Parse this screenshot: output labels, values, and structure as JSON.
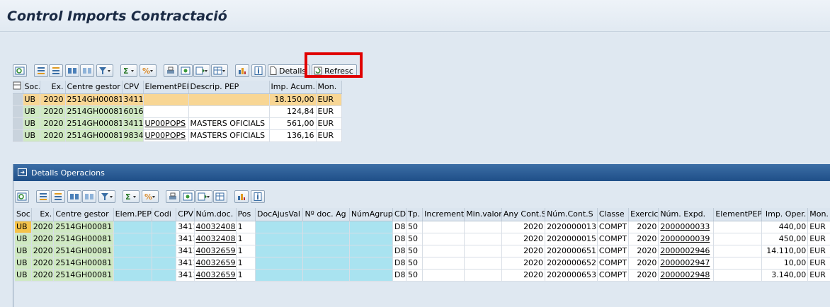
{
  "title": "Control Imports Contractació",
  "toolbar1": {
    "icons": [
      "details-icon",
      "align-left-icon",
      "align-center-icon",
      "find-icon",
      "find-next-icon",
      "filter-icon",
      "sum-icon",
      "subtotal-icon",
      "print-icon",
      "view-icon",
      "export-icon",
      "layout-icon",
      "graphic-icon",
      "info-icon"
    ],
    "details_label": "Detalls",
    "refresh_label": "Refresc"
  },
  "top_table": {
    "columns": [
      "Soc.",
      "Ex.",
      "Centre gestor",
      "CPV",
      "ElementPEP",
      "Descrip. PEP",
      "Imp. Acum.",
      "Mon."
    ],
    "rows": [
      [
        "UB",
        "2020",
        "2514GH00081",
        "3411",
        "",
        "",
        "18.150,00",
        "EUR"
      ],
      [
        "UB",
        "2020",
        "2514GH00081",
        "6016",
        "",
        "",
        "124,84",
        "EUR"
      ],
      [
        "UB",
        "2020",
        "2514GH00081",
        "3411",
        "UP00POPS",
        "MASTERS OFICIALS",
        "561,00",
        "EUR"
      ],
      [
        "UB",
        "2020",
        "2514GH00081",
        "9834",
        "UP00POPS",
        "MASTERS OFICIALS",
        "136,16",
        "EUR"
      ]
    ]
  },
  "panel2": {
    "title": "Detalls Operacions"
  },
  "bottom_table": {
    "columns": [
      "Soc.",
      "Ex.",
      "Centre gestor",
      "Elem.PEP",
      "Codi",
      "CPV",
      "Núm.doc.",
      "Pos",
      "DocAjusVal",
      "Nº doc. Ag",
      "NúmAgrup",
      "CD",
      "Tp.",
      "Increment",
      "Min.valor",
      "Any Cont.S",
      "Núm.Cont.S",
      "Classe",
      "Exercici",
      "Núm. Expd.",
      "ElementPEP",
      "Imp. Oper.",
      "Mon."
    ],
    "rows": [
      [
        "UB",
        "2020",
        "2514GH00081",
        "",
        "",
        "3411",
        "400324080",
        "1",
        "",
        "",
        "",
        "D8",
        "50",
        "",
        "",
        "2020",
        "2020000013",
        "COMPT",
        "2020",
        "2000000033",
        "",
        "440,00",
        "EUR"
      ],
      [
        "UB",
        "2020",
        "2514GH00081",
        "",
        "",
        "3411",
        "400324084",
        "1",
        "",
        "",
        "",
        "D8",
        "50",
        "",
        "",
        "2020",
        "2020000015",
        "COMPT",
        "2020",
        "2000000039",
        "",
        "450,00",
        "EUR"
      ],
      [
        "UB",
        "2020",
        "2514GH00081",
        "",
        "",
        "3411",
        "400326596",
        "1",
        "",
        "",
        "",
        "D8",
        "50",
        "",
        "",
        "2020",
        "2020000651",
        "COMPT",
        "2020",
        "2000002946",
        "",
        "14.110,00",
        "EUR"
      ],
      [
        "UB",
        "2020",
        "2514GH00081",
        "",
        "",
        "3411",
        "400326597",
        "1",
        "",
        "",
        "",
        "D8",
        "50",
        "",
        "",
        "2020",
        "2020000652",
        "COMPT",
        "2020",
        "2000002947",
        "",
        "10,00",
        "EUR"
      ],
      [
        "UB",
        "2020",
        "2514GH00081",
        "",
        "",
        "3411",
        "400326598",
        "1",
        "",
        "",
        "",
        "D8",
        "50",
        "",
        "",
        "2020",
        "2020000653",
        "COMPT",
        "2020",
        "2000002948",
        "",
        "3.140,00",
        "EUR"
      ]
    ]
  },
  "colors": {
    "key_column": "#cfe9c2",
    "selected_row": "#f8d694",
    "editable_cyan": "#a9e3f0",
    "panel_header": "#1f4f88",
    "highlight": "#e00000"
  }
}
